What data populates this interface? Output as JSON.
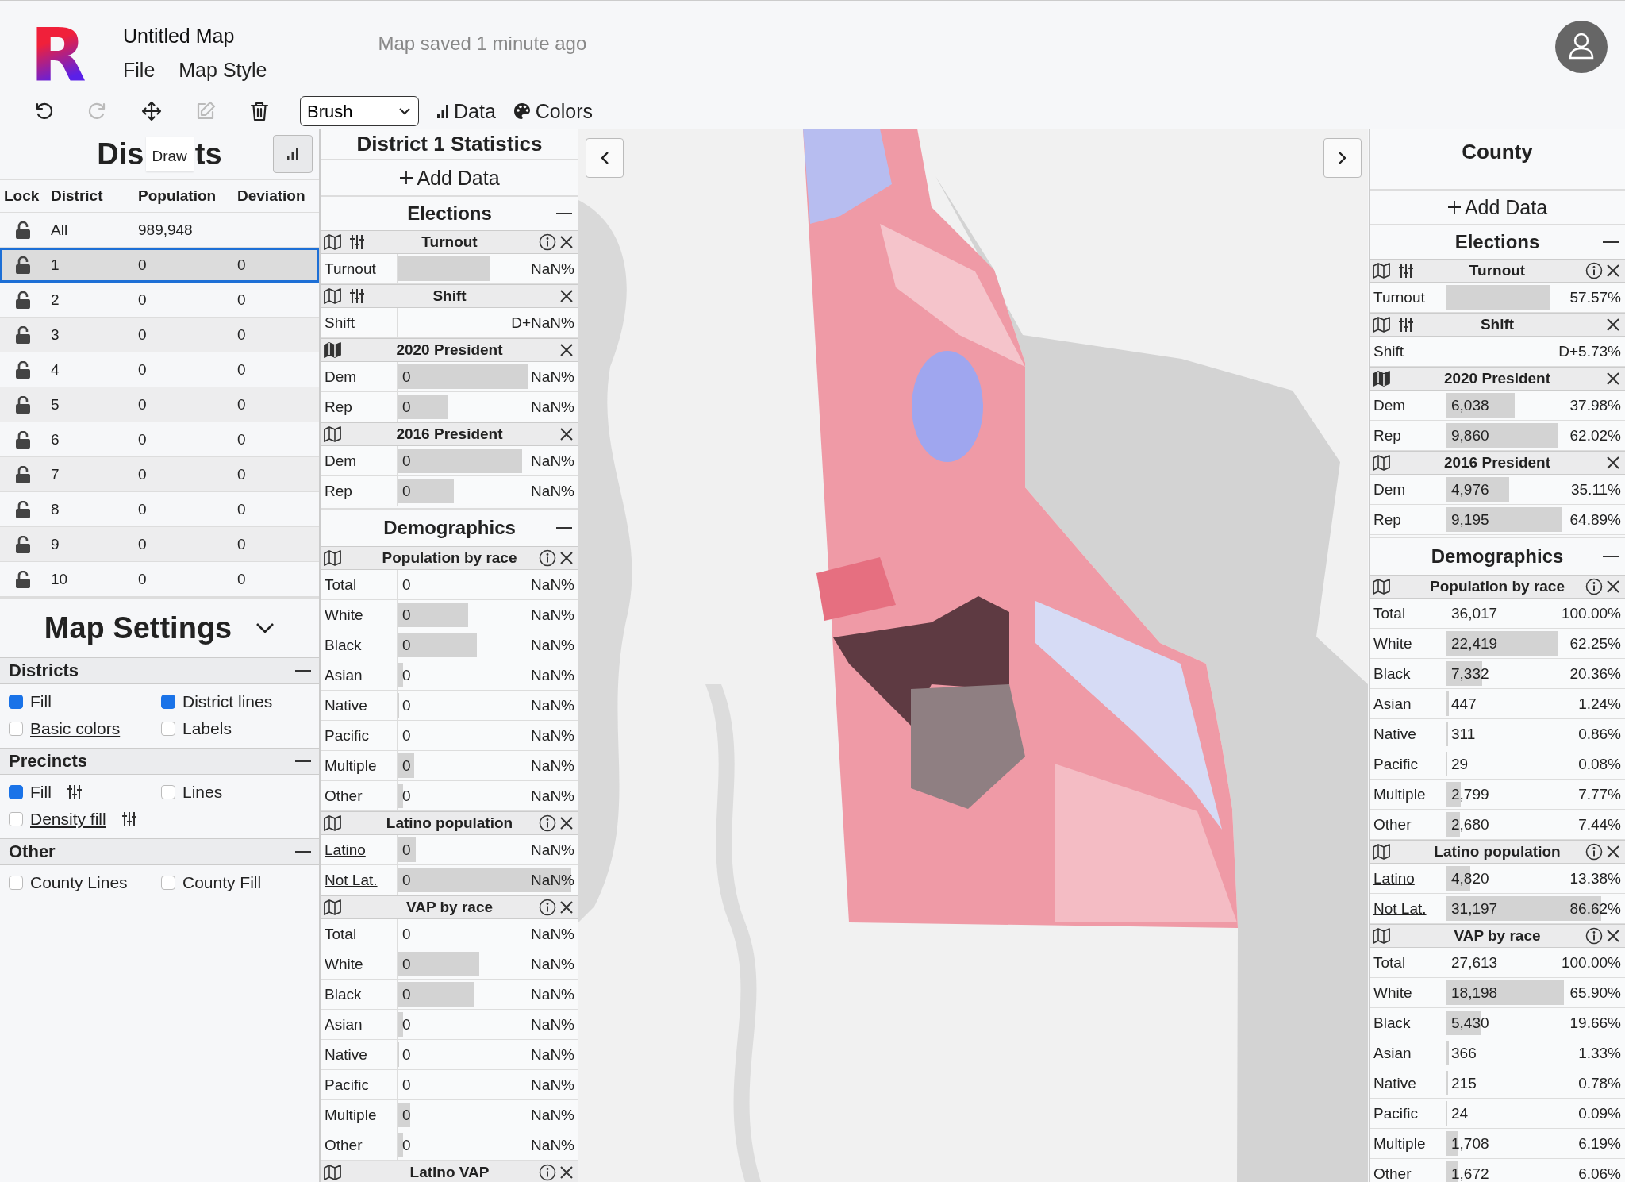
{
  "header": {
    "logo": "R",
    "title": "Untitled Map",
    "menu": [
      "File",
      "Map Style"
    ],
    "save_status": "Map saved 1 minute ago"
  },
  "toolbar": {
    "tools": [
      {
        "kind": "undo",
        "disabled": false
      },
      {
        "kind": "redo",
        "disabled": true
      },
      {
        "kind": "move",
        "disabled": false
      },
      {
        "kind": "edit",
        "disabled": true
      },
      {
        "kind": "delete",
        "disabled": false
      }
    ],
    "mode_select": "Brush",
    "buttons": [
      {
        "kind": "data",
        "label": "Data"
      },
      {
        "kind": "colors",
        "label": "Colors"
      }
    ]
  },
  "districts": {
    "title_start": "Dis",
    "tooltip": "Draw",
    "title_end": "ts",
    "columns": [
      "Lock",
      "District",
      "Population",
      "Deviation"
    ],
    "rows": [
      {
        "district": "All",
        "population": "989,948",
        "locked": false,
        "selected": false
      },
      {
        "district": "1",
        "population": "0",
        "deviation": "0",
        "locked": false,
        "selected": true
      },
      {
        "district": "2",
        "population": "0",
        "deviation": "0",
        "locked": false,
        "selected": false
      },
      {
        "district": "3",
        "population": "0",
        "deviation": "0",
        "locked": false,
        "selected": false
      },
      {
        "district": "4",
        "population": "0",
        "deviation": "0",
        "locked": false,
        "selected": false
      },
      {
        "district": "5",
        "population": "0",
        "deviation": "0",
        "locked": false,
        "selected": false
      },
      {
        "district": "6",
        "population": "0",
        "deviation": "0",
        "locked": false,
        "selected": false
      },
      {
        "district": "7",
        "population": "0",
        "deviation": "0",
        "locked": false,
        "selected": false
      },
      {
        "district": "8",
        "population": "0",
        "deviation": "0",
        "locked": false,
        "selected": false
      },
      {
        "district": "9",
        "population": "0",
        "deviation": "0",
        "locked": false,
        "selected": false
      },
      {
        "district": "10",
        "population": "0",
        "deviation": "0",
        "locked": false,
        "selected": false
      }
    ]
  },
  "map_settings": {
    "title": "Map Settings",
    "expanded": true,
    "sections": [
      {
        "title": "Districts",
        "options": [
          {
            "label": "Fill",
            "checked": true
          },
          {
            "label": "District lines",
            "checked": true
          },
          {
            "label": "Basic colors",
            "checked": false,
            "link": true
          },
          {
            "label": "Labels",
            "checked": false
          }
        ]
      },
      {
        "title": "Precincts",
        "options": [
          {
            "label": "Fill",
            "checked": true,
            "adjustable": true
          },
          {
            "label": "Lines",
            "checked": false
          },
          {
            "label": "Density fill",
            "checked": false,
            "link": true,
            "adjustable": true
          }
        ]
      },
      {
        "title": "Other",
        "options": [
          {
            "label": "County Lines",
            "checked": false
          },
          {
            "label": "County Fill",
            "checked": false
          }
        ]
      }
    ]
  },
  "stats": [
    {
      "title": "District 1 Statistics",
      "add_data": "Add Data",
      "groups": [
        {
          "title": "Elections",
          "tables": [
            {
              "title": "Turnout",
              "map_active": false,
              "adjustable": true,
              "info": true,
              "rows": [
                {
                  "label": "Turnout",
                  "level": 0.51,
                  "percent": "NaN%"
                }
              ]
            },
            {
              "title": "Shift",
              "map_active": false,
              "adjustable": true,
              "info": false,
              "rows": [
                {
                  "label": "Shift",
                  "percent": "D+NaN%"
                }
              ]
            },
            {
              "title": "2020 President",
              "map_active": true,
              "adjustable": false,
              "info": false,
              "rows": [
                {
                  "label": "Dem",
                  "value": "0",
                  "level": 0.72,
                  "percent": "NaN%"
                },
                {
                  "label": "Rep",
                  "value": "0",
                  "level": 0.28,
                  "percent": "NaN%"
                }
              ]
            },
            {
              "title": "2016 President",
              "map_active": false,
              "adjustable": false,
              "info": false,
              "rows": [
                {
                  "label": "Dem",
                  "value": "0",
                  "level": 0.69,
                  "percent": "NaN%"
                },
                {
                  "label": "Rep",
                  "value": "0",
                  "level": 0.31,
                  "percent": "NaN%"
                }
              ]
            }
          ]
        },
        {
          "title": "Demographics",
          "tables": [
            {
              "title": "Population by race",
              "map_active": false,
              "adjustable": false,
              "info": true,
              "rows": [
                {
                  "label": "Total",
                  "value": "0",
                  "percent": "NaN%"
                },
                {
                  "label": "White",
                  "value": "0",
                  "level": 0.39,
                  "percent": "NaN%"
                },
                {
                  "label": "Black",
                  "value": "0",
                  "level": 0.44,
                  "percent": "NaN%"
                },
                {
                  "label": "Asian",
                  "value": "0",
                  "level": 0.03,
                  "percent": "NaN%"
                },
                {
                  "label": "Native",
                  "value": "0",
                  "level": 0.01,
                  "percent": "NaN%"
                },
                {
                  "label": "Pacific",
                  "value": "0",
                  "percent": "NaN%"
                },
                {
                  "label": "Multiple",
                  "value": "0",
                  "level": 0.09,
                  "percent": "NaN%"
                },
                {
                  "label": "Other",
                  "value": "0",
                  "level": 0.03,
                  "percent": "NaN%"
                }
              ]
            },
            {
              "title": "Latino population",
              "map_active": false,
              "adjustable": false,
              "info": true,
              "rows": [
                {
                  "label": "Latino",
                  "link": true,
                  "value": "0",
                  "level": 0.1,
                  "percent": "NaN%"
                },
                {
                  "label": "Not Lat.",
                  "link": true,
                  "value": "0",
                  "level": 0.96,
                  "percent": "NaN%"
                }
              ]
            },
            {
              "title": "VAP by race",
              "map_active": false,
              "adjustable": false,
              "info": true,
              "rows": [
                {
                  "label": "Total",
                  "value": "0",
                  "percent": "NaN%"
                },
                {
                  "label": "White",
                  "value": "0",
                  "level": 0.45,
                  "percent": "NaN%"
                },
                {
                  "label": "Black",
                  "value": "0",
                  "level": 0.42,
                  "percent": "NaN%"
                },
                {
                  "label": "Asian",
                  "value": "0",
                  "level": 0.03,
                  "percent": "NaN%"
                },
                {
                  "label": "Native",
                  "value": "0",
                  "level": 0.01,
                  "percent": "NaN%"
                },
                {
                  "label": "Pacific",
                  "value": "0",
                  "percent": "NaN%"
                },
                {
                  "label": "Multiple",
                  "value": "0",
                  "level": 0.07,
                  "percent": "NaN%"
                },
                {
                  "label": "Other",
                  "value": "0",
                  "level": 0.03,
                  "percent": "NaN%"
                }
              ]
            },
            {
              "title": "Latino VAP",
              "map_active": false,
              "adjustable": false,
              "info": true
            }
          ]
        }
      ]
    },
    {
      "title": "County",
      "add_data": "Add Data",
      "groups": [
        {
          "title": "Elections",
          "tables": [
            {
              "title": "Turnout",
              "map_active": false,
              "adjustable": true,
              "info": true,
              "rows": [
                {
                  "label": "Turnout",
                  "level": 0.58,
                  "percent": "57.57%"
                }
              ]
            },
            {
              "title": "Shift",
              "map_active": false,
              "adjustable": true,
              "info": false,
              "rows": [
                {
                  "label": "Shift",
                  "percent": "D+5.73%"
                }
              ]
            },
            {
              "title": "2020 President",
              "map_active": true,
              "adjustable": false,
              "info": false,
              "rows": [
                {
                  "label": "Dem",
                  "value": "6,038",
                  "level": 0.38,
                  "percent": "37.98%"
                },
                {
                  "label": "Rep",
                  "value": "9,860",
                  "level": 0.62,
                  "percent": "62.02%"
                }
              ]
            },
            {
              "title": "2016 President",
              "map_active": false,
              "adjustable": false,
              "info": false,
              "rows": [
                {
                  "label": "Dem",
                  "value": "4,976",
                  "level": 0.35,
                  "percent": "35.11%"
                },
                {
                  "label": "Rep",
                  "value": "9,195",
                  "level": 0.65,
                  "percent": "64.89%"
                }
              ]
            }
          ]
        },
        {
          "title": "Demographics",
          "tables": [
            {
              "title": "Population by race",
              "map_active": false,
              "adjustable": false,
              "info": true,
              "rows": [
                {
                  "label": "Total",
                  "value": "36,017",
                  "percent": "100.00%"
                },
                {
                  "label": "White",
                  "value": "22,419",
                  "level": 0.62,
                  "percent": "62.25%"
                },
                {
                  "label": "Black",
                  "value": "7,332",
                  "level": 0.2,
                  "percent": "20.36%"
                },
                {
                  "label": "Asian",
                  "value": "447",
                  "level": 0.012,
                  "percent": "1.24%"
                },
                {
                  "label": "Native",
                  "value": "311",
                  "level": 0.009,
                  "percent": "0.86%"
                },
                {
                  "label": "Pacific",
                  "value": "29",
                  "level": 0.001,
                  "percent": "0.08%"
                },
                {
                  "label": "Multiple",
                  "value": "2,799",
                  "level": 0.078,
                  "percent": "7.77%"
                },
                {
                  "label": "Other",
                  "value": "2,680",
                  "level": 0.074,
                  "percent": "7.44%"
                }
              ]
            },
            {
              "title": "Latino population",
              "map_active": false,
              "adjustable": false,
              "info": true,
              "rows": [
                {
                  "label": "Latino",
                  "link": true,
                  "value": "4,820",
                  "level": 0.134,
                  "percent": "13.38%"
                },
                {
                  "label": "Not Lat.",
                  "link": true,
                  "value": "31,197",
                  "level": 0.866,
                  "percent": "86.62%"
                }
              ]
            },
            {
              "title": "VAP by race",
              "map_active": false,
              "adjustable": false,
              "info": true,
              "rows": [
                {
                  "label": "Total",
                  "value": "27,613",
                  "percent": "100.00%"
                },
                {
                  "label": "White",
                  "value": "18,198",
                  "level": 0.659,
                  "percent": "65.90%"
                },
                {
                  "label": "Black",
                  "value": "5,430",
                  "level": 0.197,
                  "percent": "19.66%"
                },
                {
                  "label": "Asian",
                  "value": "366",
                  "level": 0.013,
                  "percent": "1.33%"
                },
                {
                  "label": "Native",
                  "value": "215",
                  "level": 0.008,
                  "percent": "0.78%"
                },
                {
                  "label": "Pacific",
                  "value": "24",
                  "level": 0.001,
                  "percent": "0.09%"
                },
                {
                  "label": "Multiple",
                  "value": "1,708",
                  "level": 0.062,
                  "percent": "6.19%"
                },
                {
                  "label": "Other",
                  "value": "1,672",
                  "level": 0.061,
                  "percent": "6.06%"
                }
              ]
            }
          ]
        }
      ]
    }
  ]
}
